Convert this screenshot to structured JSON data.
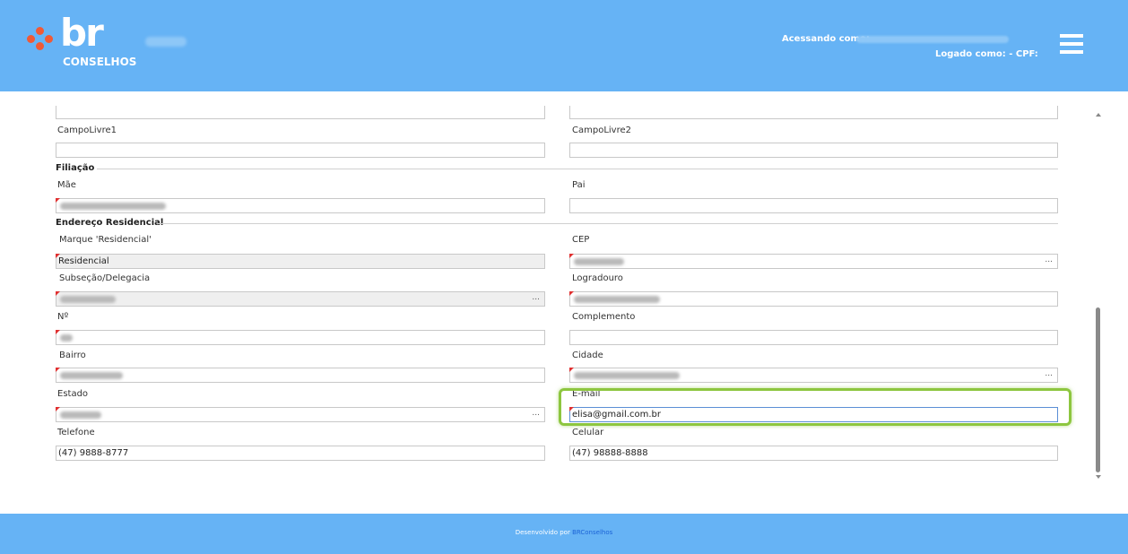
{
  "header": {
    "brand_main": "br",
    "brand_sub": "CONSELHOS",
    "accessing_label": "Acessando como:",
    "logged_label": "Logado como: - CPF:",
    "menu_icon": "hamburger-menu-icon",
    "accent": "#66b3f5",
    "logo_color": "#f05a36"
  },
  "form": {
    "campolivre1": {
      "label": "CampoLivre1",
      "value": ""
    },
    "campolivre2": {
      "label": "CampoLivre2",
      "value": ""
    },
    "filiacao": {
      "title": "Filiação"
    },
    "mae": {
      "label": "Mãe",
      "value": ""
    },
    "pai": {
      "label": "Pai",
      "value": ""
    },
    "endereco": {
      "title": "Endereço Residencial"
    },
    "marque": {
      "label": "Marque 'Residencial'",
      "value": "Residencial"
    },
    "cep": {
      "label": "CEP",
      "value": ""
    },
    "subsecao": {
      "label": "Subseção/Delegacia",
      "value": ""
    },
    "logradouro": {
      "label": "Logradouro",
      "value": ""
    },
    "numero": {
      "label": "Nº",
      "value": ""
    },
    "complemento": {
      "label": "Complemento",
      "value": ""
    },
    "bairro": {
      "label": "Bairro",
      "value": ""
    },
    "cidade": {
      "label": "Cidade",
      "value": ""
    },
    "estado": {
      "label": "Estado",
      "value": ""
    },
    "email": {
      "label": "E-mail",
      "value": "elisa@gmail.com.br"
    },
    "telefone": {
      "label": "Telefone",
      "value": "(47) 9888-8777"
    },
    "celular": {
      "label": "Celular",
      "value": "(47) 98888-8888"
    },
    "lookup_glyph": "..."
  },
  "footer": {
    "text": "Desenvolvido por",
    "link": "BRConselhos"
  }
}
